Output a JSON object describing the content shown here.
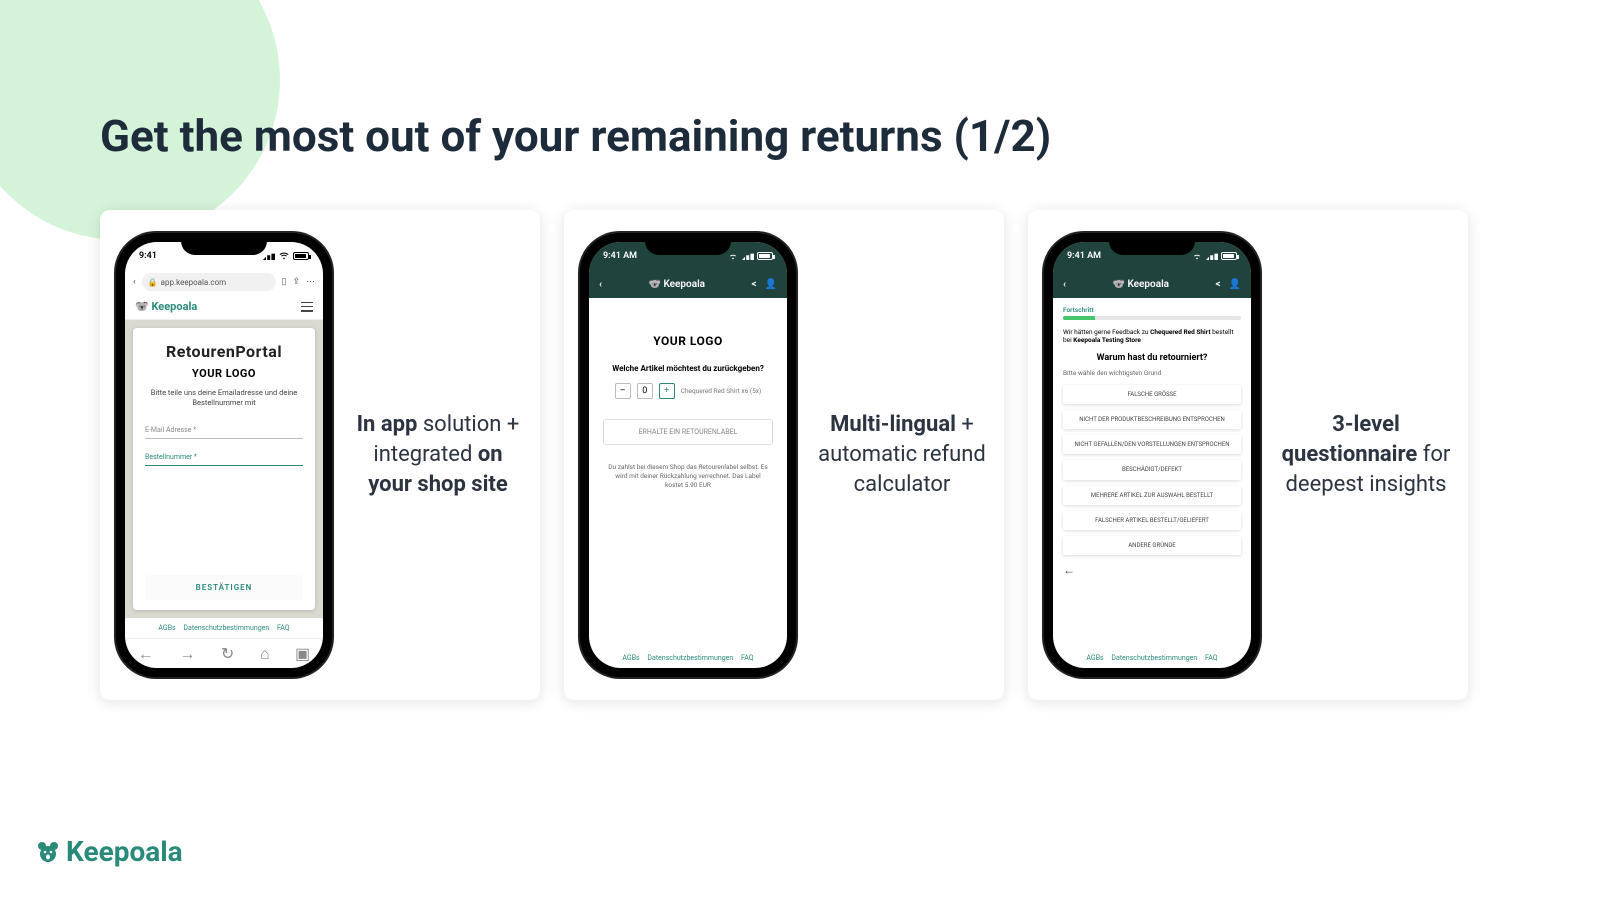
{
  "page_title": "Get the most out of your remaining returns (1/2)",
  "brand": "Keepoala",
  "panels": [
    {
      "caption_bold1": "In app",
      "caption_plain1": " solution + integrated ",
      "caption_bold2": "on your shop site",
      "phone": {
        "time": "9:41",
        "url": "app.keepoala.com",
        "app_brand": "Keepoala",
        "card_title": "RetourenPortal",
        "logo_label": "YOUR LOGO",
        "intro": "Bitte teile uns deine Emailadresse und deine Bestellnummer mit",
        "field_email": "E-Mail Adresse *",
        "field_order": "Bestellnummer *",
        "confirm": "BESTÄTIGEN",
        "footer": {
          "agb": "AGBs",
          "priv": "Datenschutzbestimmungen",
          "faq": "FAQ"
        }
      }
    },
    {
      "caption_bold1": "Multi-lingual",
      "caption_plain1": " + automatic refund calculator",
      "phone": {
        "time": "9:41 AM",
        "app_brand": "Keepoala",
        "logo_label": "YOUR LOGO",
        "question": "Welche Artikel möchtest du zurückgeben?",
        "minus": "–",
        "qty": "0",
        "plus": "+",
        "item": "Chequered Red Shirt x6 (5x)",
        "get_label": "ERHALTE EIN RETOURENLABEL",
        "note": "Du zahlst bei diesem Shop das Retourenlabel selbst. Es wird mit deiner Rückzahlung verrechnet. Das Label kostet 5.90 EUR",
        "footer": {
          "agb": "AGBs",
          "priv": "Datenschutzbestimmungen",
          "faq": "FAQ"
        }
      }
    },
    {
      "caption_bold1": "3-level questionnaire",
      "caption_plain1": " for deepest insights",
      "phone": {
        "time": "9:41 AM",
        "app_brand": "Keepoala",
        "progress_label": "Fortschritt",
        "feedback_pre": "Wir hätten gerne Feedback zu ",
        "feedback_item": "Chequered Red Shirt",
        "feedback_mid": " bestellt bei ",
        "feedback_store": "Keepoala Testing Store",
        "question": "Warum hast du retourniert?",
        "subtitle": "Bitte wähle den wichtigsten Grund",
        "options": [
          "FALSCHE GRÖSSE",
          "NICHT DER PRODUKTBESCHREIBUNG ENTSPROCHEN",
          "NICHT GEFALLEN/DEN VORSTELLUNGEN ENTSPROCHEN",
          "BESCHÄDIGT/DEFEKT",
          "MEHRERE ARTIKEL ZUR AUSWAHL BESTELLT",
          "FALSCHER ARTIKEL BESTELLT/GELIEFERT",
          "ANDERE GRÜNDE"
        ],
        "footer": {
          "agb": "AGBs",
          "priv": "Datenschutzbestimmungen",
          "faq": "FAQ"
        }
      }
    }
  ]
}
